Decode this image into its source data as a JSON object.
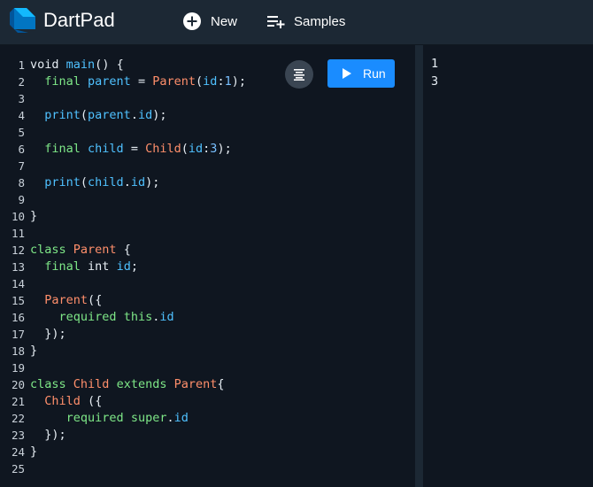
{
  "header": {
    "title": "DartPad",
    "new_label": "New",
    "samples_label": "Samples",
    "logo_icon": "dart-logo-icon",
    "new_icon": "add-circle-icon",
    "samples_icon": "playlist-add-icon"
  },
  "toolbar": {
    "run_label": "Run",
    "run_icon": "play-icon",
    "format_icon": "format-align-icon"
  },
  "colors": {
    "accent": "#1a8cff",
    "editor_bg": "#0f1620",
    "header_bg": "#1c2834"
  },
  "editor": {
    "line_numbers": [
      "1",
      "2",
      "3",
      "4",
      "5",
      "6",
      "7",
      "8",
      "9",
      "10",
      "11",
      "12",
      "13",
      "14",
      "15",
      "16",
      "17",
      "18",
      "19",
      "20",
      "21",
      "22",
      "23",
      "24",
      "25"
    ],
    "lines": [
      "void main() {",
      "  final parent = Parent(id:1);",
      "",
      "  print(parent.id);",
      "",
      "  final child = Child(id:3);",
      "",
      "  print(child.id);",
      "",
      "}",
      "",
      "class Parent {",
      "  final int id;",
      "",
      "  Parent({",
      "    required this.id",
      "  });",
      "}",
      "",
      "class Child extends Parent{",
      "  Child ({",
      "     required super.id",
      "  });",
      "}",
      ""
    ]
  },
  "output": {
    "lines": [
      "1",
      "3"
    ]
  }
}
